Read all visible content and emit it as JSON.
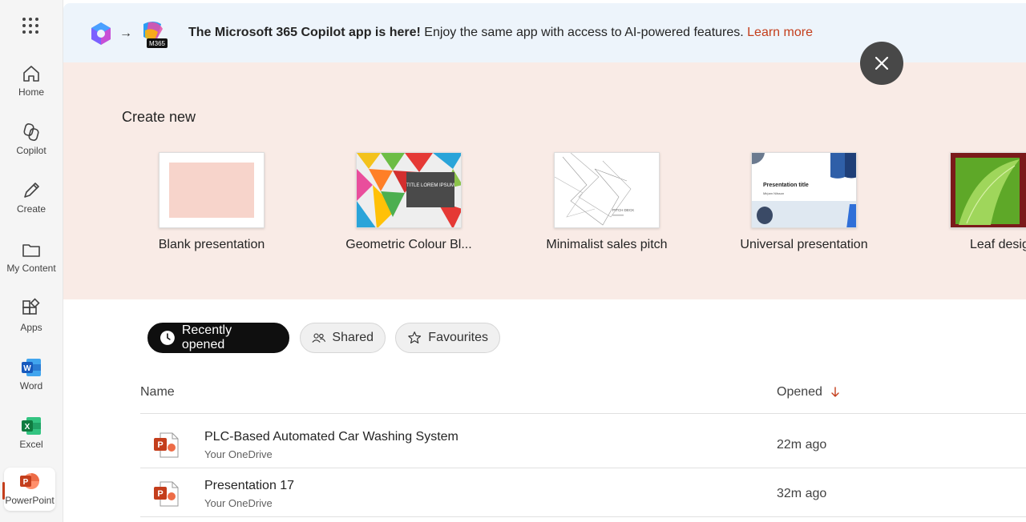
{
  "rail": {
    "items": [
      {
        "label": "Home",
        "icon": "home-icon"
      },
      {
        "label": "Copilot",
        "icon": "copilot-icon"
      },
      {
        "label": "Create",
        "icon": "pencil-icon"
      },
      {
        "label": "My Content",
        "icon": "folder-icon"
      },
      {
        "label": "Apps",
        "icon": "apps-icon"
      },
      {
        "label": "Word",
        "icon": "word-icon"
      },
      {
        "label": "Excel",
        "icon": "excel-icon"
      },
      {
        "label": "PowerPoint",
        "icon": "powerpoint-icon"
      }
    ]
  },
  "banner": {
    "bold": "The Microsoft 365 Copilot app is here!",
    "rest": " Enjoy the same app with access to AI-powered features. ",
    "link": "Learn more",
    "badge": "M365"
  },
  "create": {
    "heading": "Create new",
    "templates": [
      {
        "name": "Blank presentation"
      },
      {
        "name": "Geometric Colour Bl...",
        "thumb_text": "TITLE LOREM IPSUM"
      },
      {
        "name": "Minimalist sales pitch",
        "thumb_text": "PITCH DECK"
      },
      {
        "name": "Universal presentation",
        "thumb_text": "Presentation title",
        "thumb_sub": "Mirjam Nilsson"
      },
      {
        "name": "Leaf desig"
      }
    ]
  },
  "tabs": {
    "recent": "Recently opened",
    "shared": "Shared",
    "favourites": "Favourites"
  },
  "table": {
    "col_name": "Name",
    "col_opened": "Opened",
    "rows": [
      {
        "title": "PLC-Based Automated Car Washing System",
        "location": "Your OneDrive",
        "opened": "22m ago"
      },
      {
        "title": "Presentation 17",
        "location": "Your OneDrive",
        "opened": "32m ago"
      }
    ]
  },
  "colors": {
    "accent": "#c43e1c",
    "banner_bg": "#edf4fb",
    "create_bg": "#f9ebe6"
  }
}
